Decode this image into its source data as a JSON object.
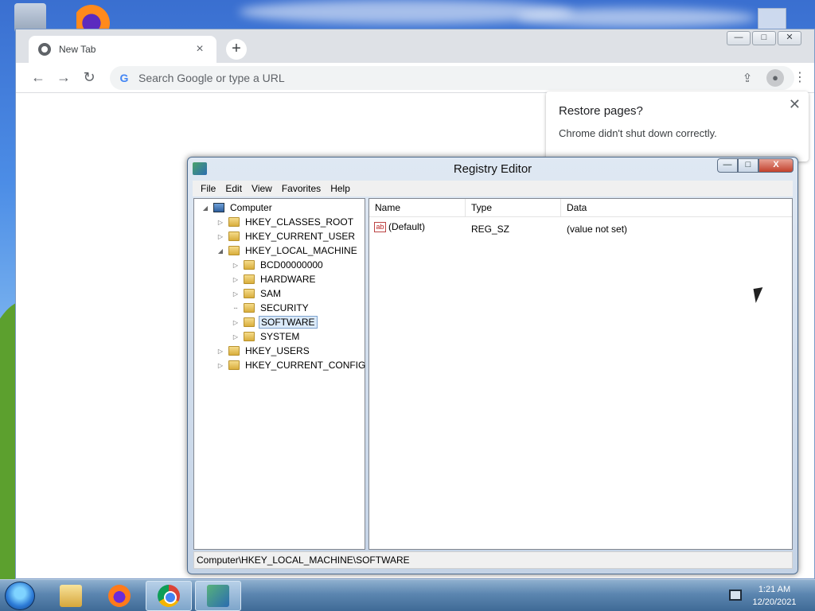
{
  "desktop": {
    "icons": [
      "recycle-bin",
      "firefox",
      "blank-document"
    ]
  },
  "chrome": {
    "tab_title": "New Tab",
    "tab_close": "×",
    "new_tab": "+",
    "window_controls": {
      "minimize": "—",
      "maximize": "□",
      "close": "✕"
    },
    "nav": {
      "back": "←",
      "forward": "→",
      "reload": "↻"
    },
    "omnibox_placeholder": "Search Google or type a URL",
    "omnibox_icon": "G",
    "restore_popup": {
      "title": "Restore pages?",
      "message": "Chrome didn't shut down correctly.",
      "close": "✕"
    }
  },
  "regedit": {
    "title": "Registry Editor",
    "controls": {
      "minimize": "—",
      "maximize": "□",
      "close": "X"
    },
    "menu": [
      "File",
      "Edit",
      "View",
      "Favorites",
      "Help"
    ],
    "tree": {
      "root": "Computer",
      "hives": [
        "HKEY_CLASSES_ROOT",
        "HKEY_CURRENT_USER",
        "HKEY_LOCAL_MACHINE"
      ],
      "hklm_children": [
        "BCD00000000",
        "HARDWARE",
        "SAM",
        "SECURITY",
        "SOFTWARE",
        "SYSTEM"
      ],
      "selected": "SOFTWARE",
      "tail_hives": [
        "HKEY_USERS",
        "HKEY_CURRENT_CONFIG"
      ]
    },
    "list": {
      "columns": [
        "Name",
        "Type",
        "Data"
      ],
      "rows": [
        {
          "icon": "ab",
          "name": "(Default)",
          "type": "REG_SZ",
          "data": "(value not set)"
        }
      ]
    },
    "status": "Computer\\HKEY_LOCAL_MACHINE\\SOFTWARE"
  },
  "taskbar": {
    "apps": [
      "windows-explorer",
      "firefox",
      "chrome",
      "registry-editor"
    ],
    "active": [
      "chrome",
      "registry-editor"
    ],
    "clock": {
      "time": "1:21 AM",
      "date": "12/20/2021"
    }
  }
}
